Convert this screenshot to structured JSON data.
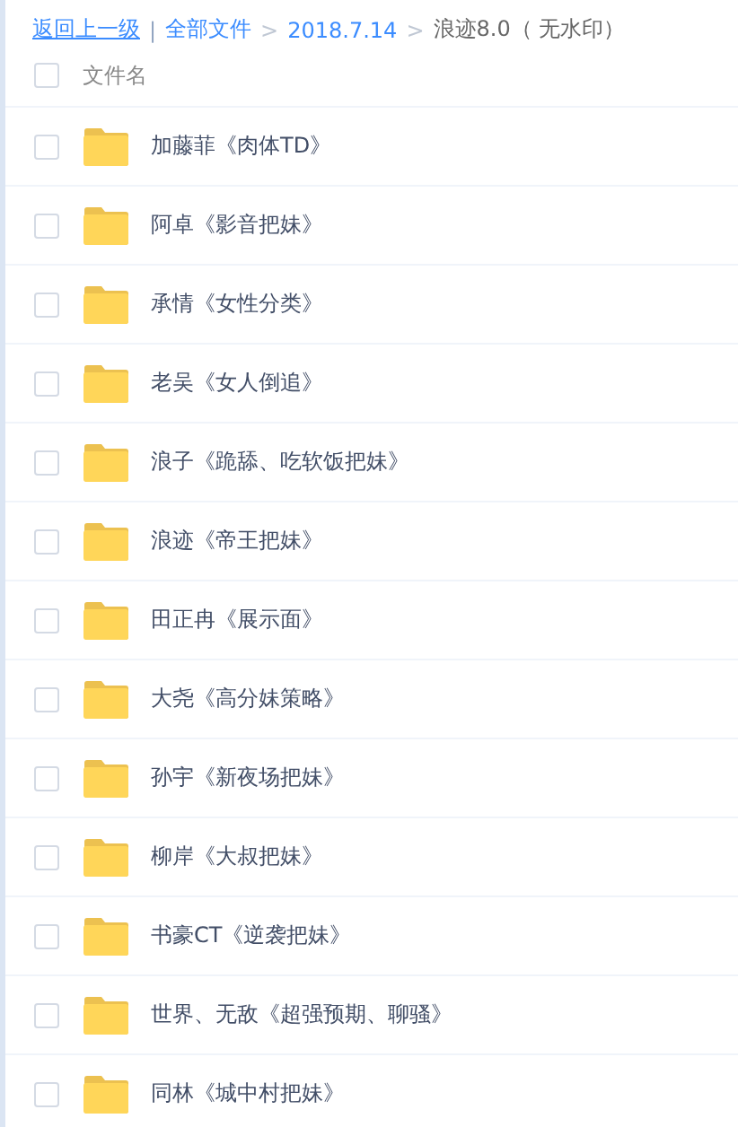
{
  "breadcrumb": {
    "back": "返回上一级",
    "separator": "|",
    "crumbs": [
      {
        "label": "全部文件",
        "kind": "link"
      },
      {
        "label": ">",
        "kind": "arrow"
      },
      {
        "label": "2018.7.14",
        "kind": "link"
      },
      {
        "label": ">",
        "kind": "arrow"
      },
      {
        "label": "浪迹8.0（ 无水印）",
        "kind": "current"
      }
    ]
  },
  "header": {
    "label": "文件名",
    "checked": false
  },
  "files": [
    {
      "name": "加藤菲《肉体TD》",
      "checked": false
    },
    {
      "name": "阿卓《影音把妹》",
      "checked": false
    },
    {
      "name": "承情《女性分类》",
      "checked": false
    },
    {
      "name": "老吴《女人倒追》",
      "checked": false
    },
    {
      "name": "浪子《跪舔、吃软饭把妹》",
      "checked": false
    },
    {
      "name": "浪迹《帝王把妹》",
      "checked": false
    },
    {
      "name": "田正冉《展示面》",
      "checked": false
    },
    {
      "name": "大尧《高分妹策略》",
      "checked": false
    },
    {
      "name": "孙宇《新夜场把妹》",
      "checked": false
    },
    {
      "name": "柳岸《大叔把妹》",
      "checked": false
    },
    {
      "name": "书豪CT《逆袭把妹》",
      "checked": false
    },
    {
      "name": "世界、无敌《超强预期、聊骚》",
      "checked": false
    },
    {
      "name": "同林《城中村把妹》",
      "checked": false
    }
  ]
}
